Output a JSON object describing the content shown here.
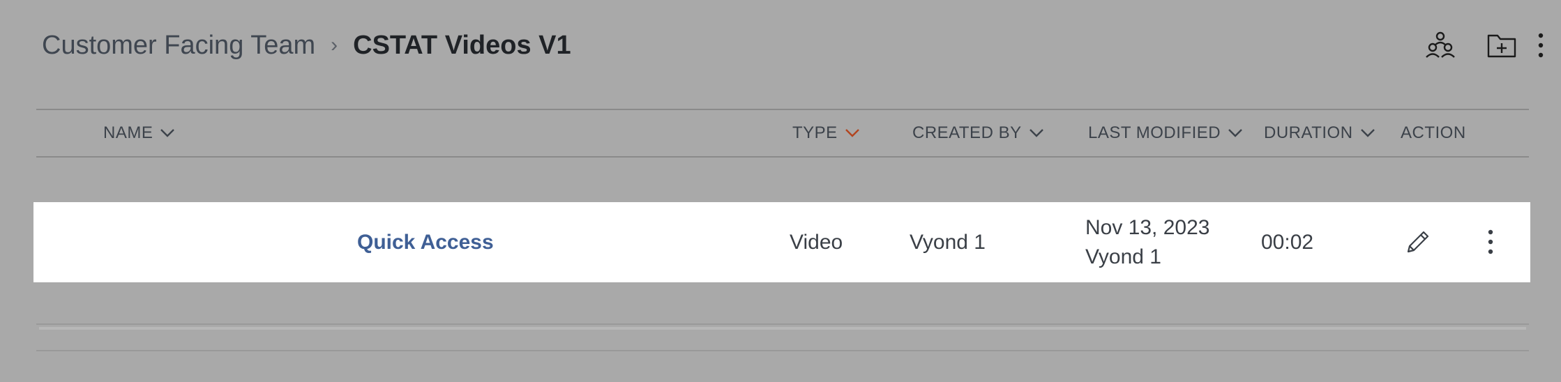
{
  "breadcrumb": {
    "parent": "Customer Facing Team",
    "separator": "›",
    "current": "CSTAT Videos V1"
  },
  "header_icons": [
    "team-members-icon",
    "new-folder-icon",
    "more-options-icon"
  ],
  "columns": [
    {
      "label": "NAME",
      "sort_icon": "chevron-down-icon"
    },
    {
      "label": "TYPE",
      "sort_icon": "chevron-down-icon",
      "active_sort": true
    },
    {
      "label": "CREATED BY",
      "sort_icon": "chevron-down-icon"
    },
    {
      "label": "LAST MODIFIED",
      "sort_icon": "chevron-down-icon"
    },
    {
      "label": "DURATION",
      "sort_icon": "chevron-down-icon"
    },
    {
      "label": "ACTION"
    }
  ],
  "rows": [
    {
      "name": "Quick Access",
      "type": "Video",
      "created_by": "Vyond 1",
      "last_modified_date": "Nov 13, 2023",
      "last_modified_by": "Vyond 1",
      "duration": "00:02",
      "actions": [
        "pencil-icon",
        "more-options-icon"
      ]
    }
  ],
  "colors": {
    "background": "#a9a9a9",
    "row_background": "#ffffff",
    "link": "#3f5f95",
    "active_sort": "#b2451f"
  }
}
